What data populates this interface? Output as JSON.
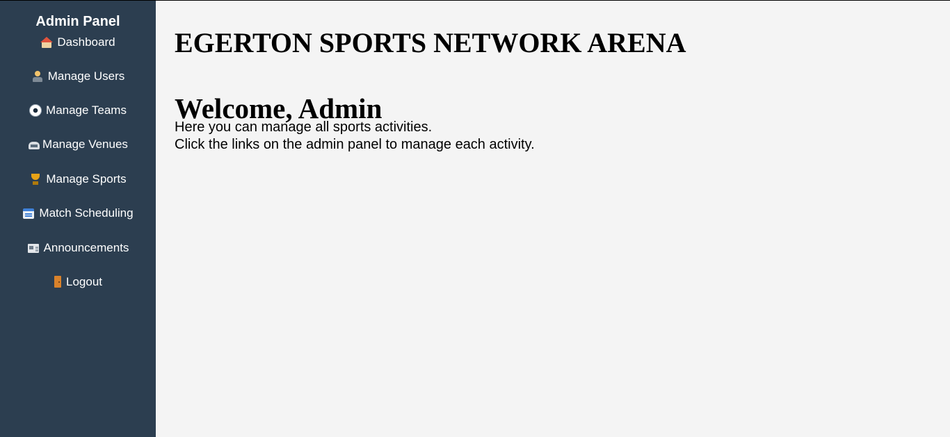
{
  "sidebar": {
    "title": "Admin Panel",
    "items": [
      {
        "label": "Dashboard",
        "icon": "home-icon"
      },
      {
        "label": "Manage Users",
        "icon": "users-icon"
      },
      {
        "label": "Manage Teams",
        "icon": "soccer-ball-icon"
      },
      {
        "label": "Manage Venues",
        "icon": "stadium-icon"
      },
      {
        "label": "Manage Sports",
        "icon": "trophy-icon"
      },
      {
        "label": "Match Scheduling",
        "icon": "calendar-icon"
      },
      {
        "label": "Announcements",
        "icon": "newspaper-icon"
      },
      {
        "label": "Logout",
        "icon": "door-icon"
      }
    ]
  },
  "main": {
    "site_title": "EGERTON SPORTS NETWORK ARENA",
    "welcome_heading": "Welcome, Admin",
    "intro_line1": "Here you can manage all sports activities.",
    "intro_line2": "Click the links on the admin panel to manage each activity."
  },
  "colors": {
    "sidebar_bg": "#2c3e50",
    "page_bg": "#f4f4f4",
    "sidebar_text": "#ffffff"
  }
}
